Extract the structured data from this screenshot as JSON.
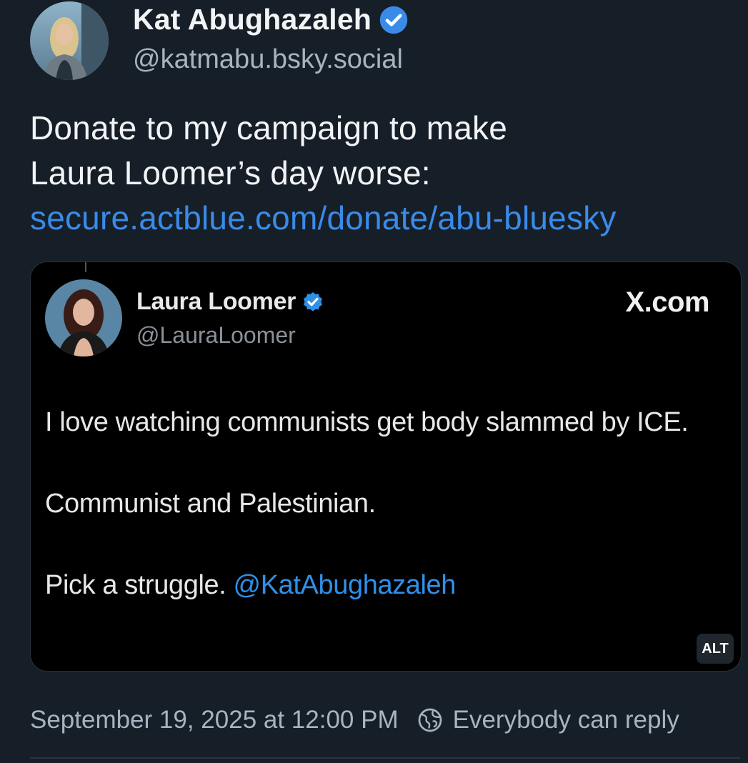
{
  "post": {
    "author": {
      "display_name": "Kat Abughazaleh",
      "handle": "@katmabu.bsky.social",
      "verified": true
    },
    "text_lines": [
      "Donate to my campaign to make",
      "Laura Loomer’s day worse:"
    ],
    "link_text": "secure.actblue.com/donate/abu-bluesky",
    "embed": {
      "quoted_author": {
        "display_name": "Laura Loomer",
        "handle": "@LauraLoomer",
        "verified": true
      },
      "source_label": "X.com",
      "body": {
        "p1": "I love watching communists get body slammed by ICE.",
        "p2": "Communist and Palestinian.",
        "p3_prefix": "Pick a struggle. ",
        "p3_mention": "@KatAbughazaleh"
      },
      "alt_label": "ALT"
    },
    "timestamp": "September 19, 2025 at 12:00 PM",
    "reply_setting": "Everybody can reply"
  },
  "colors": {
    "background": "#161e27",
    "link": "#3a8be8",
    "verified_badge": "#3a8be8",
    "muted_text": "#a8b3c1"
  },
  "icons": [
    "verified-badge-icon",
    "globe-icon"
  ]
}
